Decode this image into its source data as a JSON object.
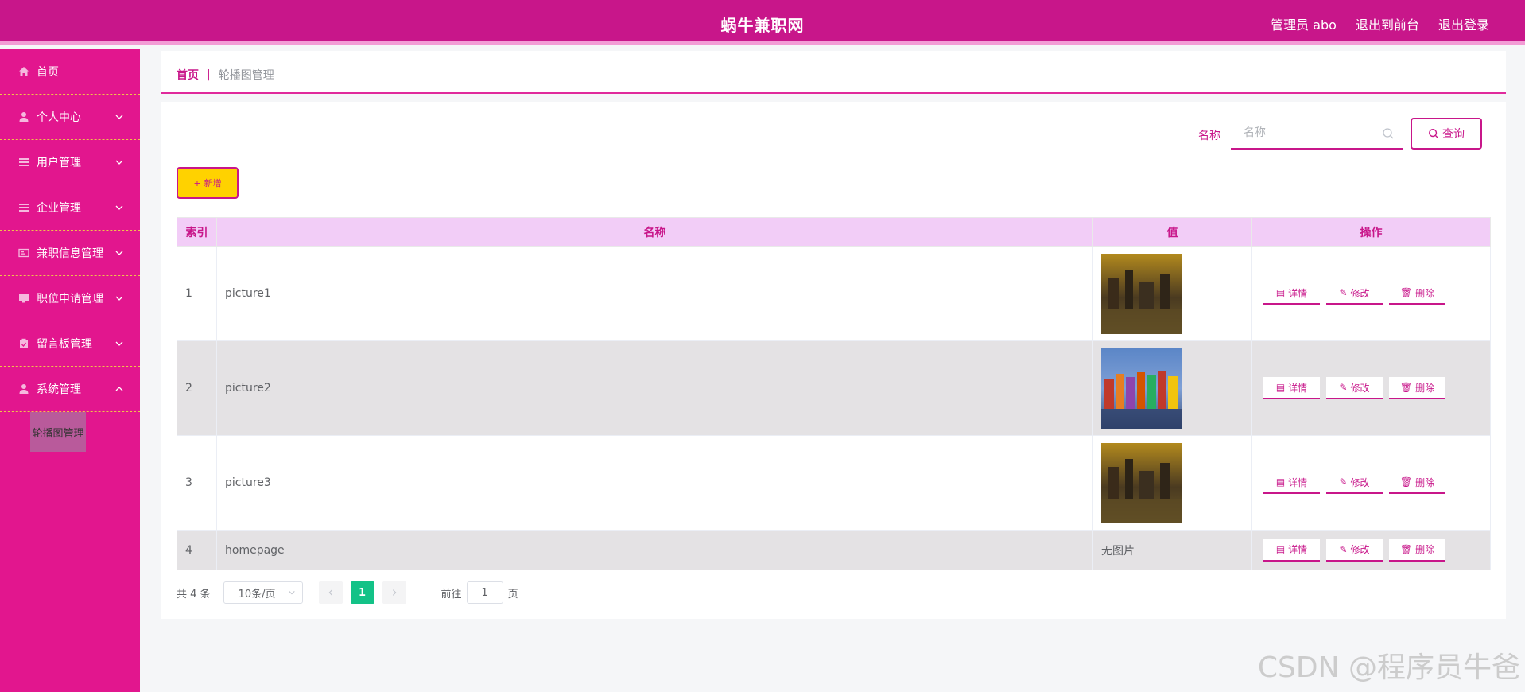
{
  "header": {
    "title": "蜗牛兼职网",
    "admin_label": "管理员 abo",
    "front_link": "退出到前台",
    "logout_link": "退出登录"
  },
  "sidebar": {
    "items": [
      {
        "label": "首页",
        "icon": "home-icon"
      },
      {
        "label": "个人中心",
        "icon": "user-icon"
      },
      {
        "label": "用户管理",
        "icon": "list-icon"
      },
      {
        "label": "企业管理",
        "icon": "list-icon"
      },
      {
        "label": "兼职信息管理",
        "icon": "card-icon"
      },
      {
        "label": "职位申请管理",
        "icon": "monitor-icon"
      },
      {
        "label": "留言板管理",
        "icon": "clipboard-icon"
      },
      {
        "label": "系统管理",
        "icon": "user-icon"
      }
    ],
    "submenu": {
      "label": "轮播图管理"
    }
  },
  "breadcrumb": {
    "home": "首页",
    "separator": "|",
    "current": "轮播图管理"
  },
  "search": {
    "label": "名称",
    "placeholder": "名称",
    "button": "查询"
  },
  "toolbar": {
    "add_label": "新增"
  },
  "table": {
    "headers": [
      "索引",
      "名称",
      "值",
      "操作"
    ],
    "rows": [
      {
        "index": "1",
        "name": "picture1",
        "value": "image"
      },
      {
        "index": "2",
        "name": "picture2",
        "value": "image"
      },
      {
        "index": "3",
        "name": "picture3",
        "value": "image"
      },
      {
        "index": "4",
        "name": "homepage",
        "value": "无图片"
      }
    ],
    "actions": {
      "detail": "详情",
      "edit": "修改",
      "delete": "删除"
    }
  },
  "pagination": {
    "total": "共 4 条",
    "page_size": "10条/页",
    "current_page": "1",
    "goto_prefix": "前往",
    "goto_value": "1",
    "goto_suffix": "页"
  },
  "watermark": "CSDN @程序员牛爸",
  "colors": {
    "accent": "#c8168a",
    "sidebar": "#e2168e",
    "add_button": "#ffd200",
    "active_page": "#13c287"
  }
}
